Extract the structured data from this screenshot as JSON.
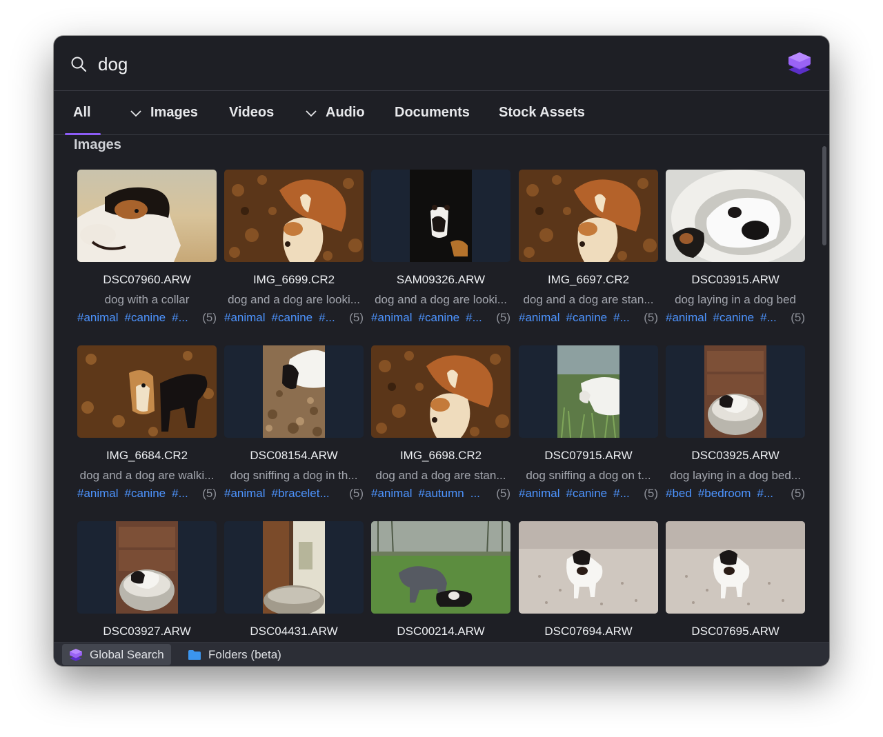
{
  "search": {
    "query": "dog"
  },
  "tabs": [
    {
      "label": "All",
      "active": true,
      "has_chevron": false
    },
    {
      "label": "Images",
      "active": false,
      "has_chevron": true
    },
    {
      "label": "Videos",
      "active": false,
      "has_chevron": false
    },
    {
      "label": "Audio",
      "active": false,
      "has_chevron": true
    },
    {
      "label": "Documents",
      "active": false,
      "has_chevron": false
    },
    {
      "label": "Stock Assets",
      "active": false,
      "has_chevron": false
    }
  ],
  "section_title": "Images",
  "results": [
    {
      "filename": "DSC07960.ARW",
      "description": "dog with a collar",
      "tags": [
        "#animal",
        "#canine",
        "#..."
      ],
      "count": "(5)",
      "thumb": "beach-closeup"
    },
    {
      "filename": "IMG_6699.CR2",
      "description": "dog and a dog are looki...",
      "tags": [
        "#animal",
        "#canine",
        "#..."
      ],
      "count": "(5)",
      "thumb": "leaves-two-dogs"
    },
    {
      "filename": "SAM09326.ARW",
      "description": "dog and a dog are looki...",
      "tags": [
        "#animal",
        "#canine",
        "#..."
      ],
      "count": "(5)",
      "thumb": "portrait-dark-dogs"
    },
    {
      "filename": "IMG_6697.CR2",
      "description": "dog and a dog are stan...",
      "tags": [
        "#animal",
        "#canine",
        "#..."
      ],
      "count": "(5)",
      "thumb": "leaves-two-dogs"
    },
    {
      "filename": "DSC03915.ARW",
      "description": "dog laying in a dog bed",
      "tags": [
        "#animal",
        "#canine",
        "#..."
      ],
      "count": "(5)",
      "thumb": "dog-in-bed-top"
    },
    {
      "filename": "IMG_6684.CR2",
      "description": "dog and a dog are walki...",
      "tags": [
        "#animal",
        "#canine",
        "#..."
      ],
      "count": "(5)",
      "thumb": "leaves-walking"
    },
    {
      "filename": "DSC08154.ARW",
      "description": "dog sniffing a dog in th...",
      "tags": [
        "#animal",
        "#bracelet..."
      ],
      "count": "(5)",
      "thumb": "portrait-leaves-sniff"
    },
    {
      "filename": "IMG_6698.CR2",
      "description": "dog and a dog are stan...",
      "tags": [
        "#animal",
        "#autumn",
        "..."
      ],
      "count": "(5)",
      "thumb": "leaves-two-dogs"
    },
    {
      "filename": "DSC07915.ARW",
      "description": "dog sniffing a dog on t...",
      "tags": [
        "#animal",
        "#canine",
        "#..."
      ],
      "count": "(5)",
      "thumb": "portrait-grass"
    },
    {
      "filename": "DSC03925.ARW",
      "description": "dog laying in a dog bed...",
      "tags": [
        "#bed",
        "#bedroom",
        "#..."
      ],
      "count": "(5)",
      "thumb": "portrait-bed"
    },
    {
      "filename": "DSC03927.ARW",
      "description": "",
      "tags": [],
      "count": "",
      "thumb": "portrait-bed"
    },
    {
      "filename": "DSC04431.ARW",
      "description": "",
      "tags": [],
      "count": "",
      "thumb": "portrait-room"
    },
    {
      "filename": "DSC00214.ARW",
      "description": "",
      "tags": [],
      "count": "",
      "thumb": "park-dogs"
    },
    {
      "filename": "DSC07694.ARW",
      "description": "",
      "tags": [],
      "count": "",
      "thumb": "beach-dog"
    },
    {
      "filename": "DSC07695.ARW",
      "description": "",
      "tags": [],
      "count": "",
      "thumb": "beach-dog"
    }
  ],
  "footer": [
    {
      "label": "Global Search",
      "icon": "cube-logo-icon",
      "active": true
    },
    {
      "label": "Folders (beta)",
      "icon": "folder-icon",
      "active": false
    }
  ],
  "colors": {
    "accent": "#8c5cf6",
    "tag": "#4d94ff",
    "background": "#1e1f25"
  }
}
